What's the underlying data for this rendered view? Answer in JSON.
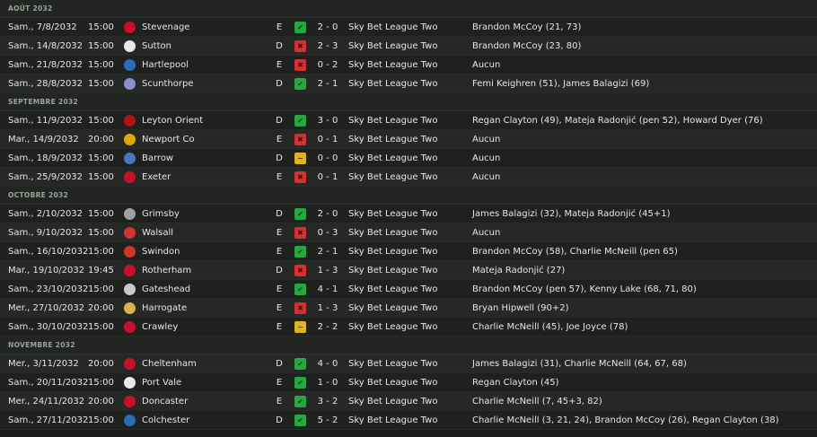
{
  "months": [
    {
      "label": "AOÛT 2032",
      "matches": [
        {
          "date": "Sam., 7/8/2032",
          "time": "15:00",
          "badge": "#c8102e",
          "opponent": "Stevenage",
          "venue": "E",
          "result": "W",
          "result_icon": "check-icon",
          "score": "2 - 0",
          "competition": "Sky Bet League Two",
          "scorers": "Brandon McCoy (21, 73)"
        },
        {
          "date": "Sam., 14/8/2032",
          "time": "15:00",
          "badge": "#e8e8e8",
          "opponent": "Sutton",
          "venue": "D",
          "result": "L",
          "result_icon": "cross-icon",
          "score": "2 - 3",
          "competition": "Sky Bet League Two",
          "scorers": "Brandon McCoy (23, 80)"
        },
        {
          "date": "Sam., 21/8/2032",
          "time": "15:00",
          "badge": "#2c6bb5",
          "opponent": "Hartlepool",
          "venue": "E",
          "result": "L",
          "result_icon": "cross-icon",
          "score": "0 - 2",
          "competition": "Sky Bet League Two",
          "scorers": "Aucun"
        },
        {
          "date": "Sam., 28/8/2032",
          "time": "15:00",
          "badge": "#8a8fd0",
          "opponent": "Scunthorpe",
          "venue": "D",
          "result": "W",
          "result_icon": "check-icon",
          "score": "2 - 1",
          "competition": "Sky Bet League Two",
          "scorers": "Femi Keighren (51), James Balagizi (69)"
        }
      ]
    },
    {
      "label": "SEPTEMBRE 2032",
      "matches": [
        {
          "date": "Sam., 11/9/2032",
          "time": "15:00",
          "badge": "#b0141a",
          "opponent": "Leyton Orient",
          "venue": "D",
          "result": "W",
          "result_icon": "check-icon",
          "score": "3 - 0",
          "competition": "Sky Bet League Two",
          "scorers": "Regan Clayton (49), Mateja Radonjić (pen 52), Howard Dyer (76)"
        },
        {
          "date": "Mar., 14/9/2032",
          "time": "20:00",
          "badge": "#e0a800",
          "opponent": "Newport Co",
          "venue": "E",
          "result": "L",
          "result_icon": "cross-icon",
          "score": "0 - 1",
          "competition": "Sky Bet League Two",
          "scorers": "Aucun"
        },
        {
          "date": "Sam., 18/9/2032",
          "time": "15:00",
          "badge": "#4a78c0",
          "opponent": "Barrow",
          "venue": "D",
          "result": "D",
          "result_icon": "minus-icon",
          "score": "0 - 0",
          "competition": "Sky Bet League Two",
          "scorers": "Aucun"
        },
        {
          "date": "Sam., 25/9/2032",
          "time": "15:00",
          "badge": "#c8102e",
          "opponent": "Exeter",
          "venue": "E",
          "result": "L",
          "result_icon": "cross-icon",
          "score": "0 - 1",
          "competition": "Sky Bet League Two",
          "scorers": "Aucun"
        }
      ]
    },
    {
      "label": "OCTOBRE 2032",
      "matches": [
        {
          "date": "Sam., 2/10/2032",
          "time": "15:00",
          "badge": "#a0a0a0",
          "opponent": "Grimsby",
          "venue": "D",
          "result": "W",
          "result_icon": "check-icon",
          "score": "2 - 0",
          "competition": "Sky Bet League Two",
          "scorers": "James Balagizi (32), Mateja Radonjić (45+1)"
        },
        {
          "date": "Sam., 9/10/2032",
          "time": "15:00",
          "badge": "#d0342c",
          "opponent": "Walsall",
          "venue": "E",
          "result": "L",
          "result_icon": "cross-icon",
          "score": "0 - 3",
          "competition": "Sky Bet League Two",
          "scorers": "Aucun"
        },
        {
          "date": "Sam., 16/10/2032",
          "time": "15:00",
          "badge": "#d0342c",
          "opponent": "Swindon",
          "venue": "E",
          "result": "W",
          "result_icon": "check-icon",
          "score": "2 - 1",
          "competition": "Sky Bet League Two",
          "scorers": "Brandon McCoy (58), Charlie McNeill (pen 65)"
        },
        {
          "date": "Mar., 19/10/2032",
          "time": "19:45",
          "badge": "#c8102e",
          "opponent": "Rotherham",
          "venue": "D",
          "result": "L",
          "result_icon": "cross-icon",
          "score": "1 - 3",
          "competition": "Sky Bet League Two",
          "scorers": "Mateja Radonjić (27)"
        },
        {
          "date": "Sam., 23/10/2032",
          "time": "15:00",
          "badge": "#c8c8c8",
          "opponent": "Gateshead",
          "venue": "E",
          "result": "W",
          "result_icon": "check-icon",
          "score": "4 - 1",
          "competition": "Sky Bet League Two",
          "scorers": "Brandon McCoy (pen 57), Kenny Lake (68, 71, 80)"
        },
        {
          "date": "Mer., 27/10/2032",
          "time": "20:00",
          "badge": "#d8b24a",
          "opponent": "Harrogate",
          "venue": "E",
          "result": "L",
          "result_icon": "cross-icon",
          "score": "1 - 3",
          "competition": "Sky Bet League Two",
          "scorers": "Bryan Hipwell (90+2)"
        },
        {
          "date": "Sam., 30/10/2032",
          "time": "15:00",
          "badge": "#c8102e",
          "opponent": "Crawley",
          "venue": "E",
          "result": "D",
          "result_icon": "minus-icon",
          "score": "2 - 2",
          "competition": "Sky Bet League Two",
          "scorers": "Charlie McNeill (45), Joe Joyce (78)"
        }
      ]
    },
    {
      "label": "NOVEMBRE 2032",
      "matches": [
        {
          "date": "Mer., 3/11/2032",
          "time": "20:00",
          "badge": "#c8102e",
          "opponent": "Cheltenham",
          "venue": "D",
          "result": "W",
          "result_icon": "check-icon",
          "score": "4 - 0",
          "competition": "Sky Bet League Two",
          "scorers": "James Balagizi (31), Charlie McNeill (64, 67, 68)"
        },
        {
          "date": "Sam., 20/11/2032",
          "time": "15:00",
          "badge": "#e8e8e8",
          "opponent": "Port Vale",
          "venue": "E",
          "result": "W",
          "result_icon": "check-icon",
          "score": "1 - 0",
          "competition": "Sky Bet League Two",
          "scorers": "Regan Clayton (45)"
        },
        {
          "date": "Mer., 24/11/2032",
          "time": "20:00",
          "badge": "#c8102e",
          "opponent": "Doncaster",
          "venue": "E",
          "result": "W",
          "result_icon": "check-icon",
          "score": "3 - 2",
          "competition": "Sky Bet League Two",
          "scorers": "Charlie McNeill (7, 45+3, 82)"
        },
        {
          "date": "Sam., 27/11/2032",
          "time": "15:00",
          "badge": "#2c6bb5",
          "opponent": "Colchester",
          "venue": "D",
          "result": "W",
          "result_icon": "check-icon",
          "score": "5 - 2",
          "competition": "Sky Bet League Two",
          "scorers": "Charlie McNeill (3, 21, 24), Brandon McCoy (26), Regan Clayton (38)"
        }
      ]
    }
  ]
}
